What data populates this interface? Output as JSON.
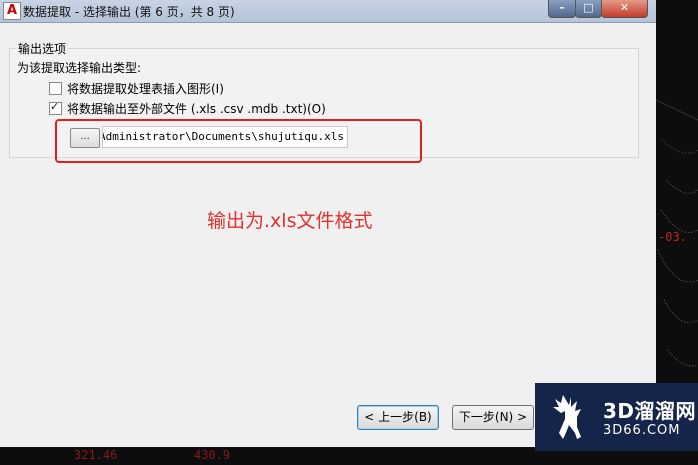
{
  "window": {
    "app_icon": "A",
    "title": "数据提取 - 选择输出 (第 6 页，共 8 页)",
    "controls": {
      "minimize": "–",
      "maximize": "□",
      "close": "✕"
    }
  },
  "output_options": {
    "group_title": "输出选项",
    "subtitle": "为该提取选择输出类型:",
    "option_insert_table": {
      "label": "将数据提取处理表插入图形(I)",
      "checked": false
    },
    "option_external_file": {
      "label": "将数据输出至外部文件  (.xls .csv .mdb .txt)(O)",
      "checked": true
    },
    "browse_label": "...",
    "file_path": "rs\\Administrator\\Documents\\shujutiqu.xls"
  },
  "annotation": {
    "note": "输出为.xls文件格式",
    "color": "#e53030"
  },
  "navigation": {
    "prev_label": "< 上一步(B)",
    "next_label": "下一步(N) >"
  },
  "background_cad": {
    "labels": [
      "-03.",
      "321.46",
      "430.9"
    ],
    "label_color": "#b22222"
  },
  "watermark": {
    "main": "3D溜溜网",
    "sub": "3D66.COM",
    "background": "#15254a"
  }
}
